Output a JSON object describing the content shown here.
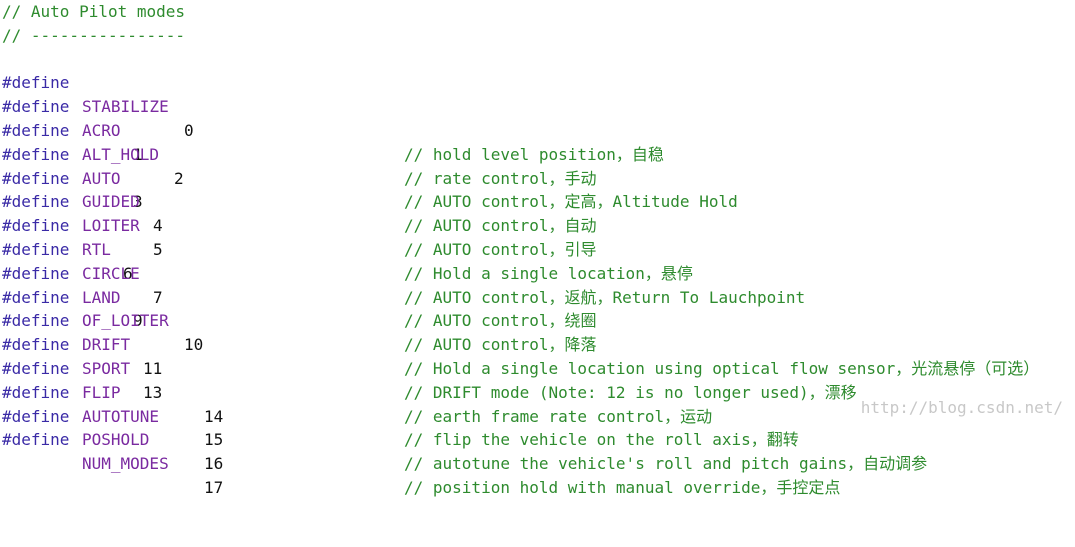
{
  "header": {
    "title_comment": "// Auto Pilot modes",
    "divider_comment": "// ----------------"
  },
  "keyword": "#define",
  "defines": [
    {
      "name": "STABILIZE",
      "value": "0",
      "comment": "// hold level position，自稳"
    },
    {
      "name": "ACRO",
      "value": "1",
      "comment": "// rate control，手动"
    },
    {
      "name": "ALT_HOLD",
      "value": "2",
      "comment": "// AUTO control，定高，Altitude Hold"
    },
    {
      "name": "AUTO",
      "value": "3",
      "comment": "// AUTO control，自动"
    },
    {
      "name": "GUIDED",
      "value": "4",
      "comment": "// AUTO control，引导"
    },
    {
      "name": "LOITER",
      "value": "5",
      "comment": "// Hold a single location，悬停"
    },
    {
      "name": "RTL",
      "value": "6",
      "comment": "// AUTO control，返航，Return To Lauchpoint"
    },
    {
      "name": "CIRCLE",
      "value": "7",
      "comment": "// AUTO control，绕圈"
    },
    {
      "name": "LAND",
      "value": "9",
      "comment": "// AUTO control，降落"
    },
    {
      "name": "OF_LOITER",
      "value": "10",
      "comment": "// Hold a single location using optical flow sensor，光流悬停（可选）"
    },
    {
      "name": "DRIFT",
      "value": "11",
      "comment": "// DRIFT mode (Note: 12 is no longer used)，漂移"
    },
    {
      "name": "SPORT",
      "value": "13",
      "comment": "// earth frame rate control，运动"
    },
    {
      "name": "FLIP",
      "value": "14",
      "comment": "// flip the vehicle on the roll axis，翻转"
    },
    {
      "name": "AUTOTUNE",
      "value": "15",
      "comment": "// autotune the vehicle's roll and pitch gains，自动调参"
    },
    {
      "name": "POSHOLD",
      "value": "16",
      "comment": "// position hold with manual override，手控定点"
    },
    {
      "name": "NUM_MODES",
      "value": "17",
      "comment": ""
    }
  ],
  "watermark": "http://blog.csdn.net/"
}
